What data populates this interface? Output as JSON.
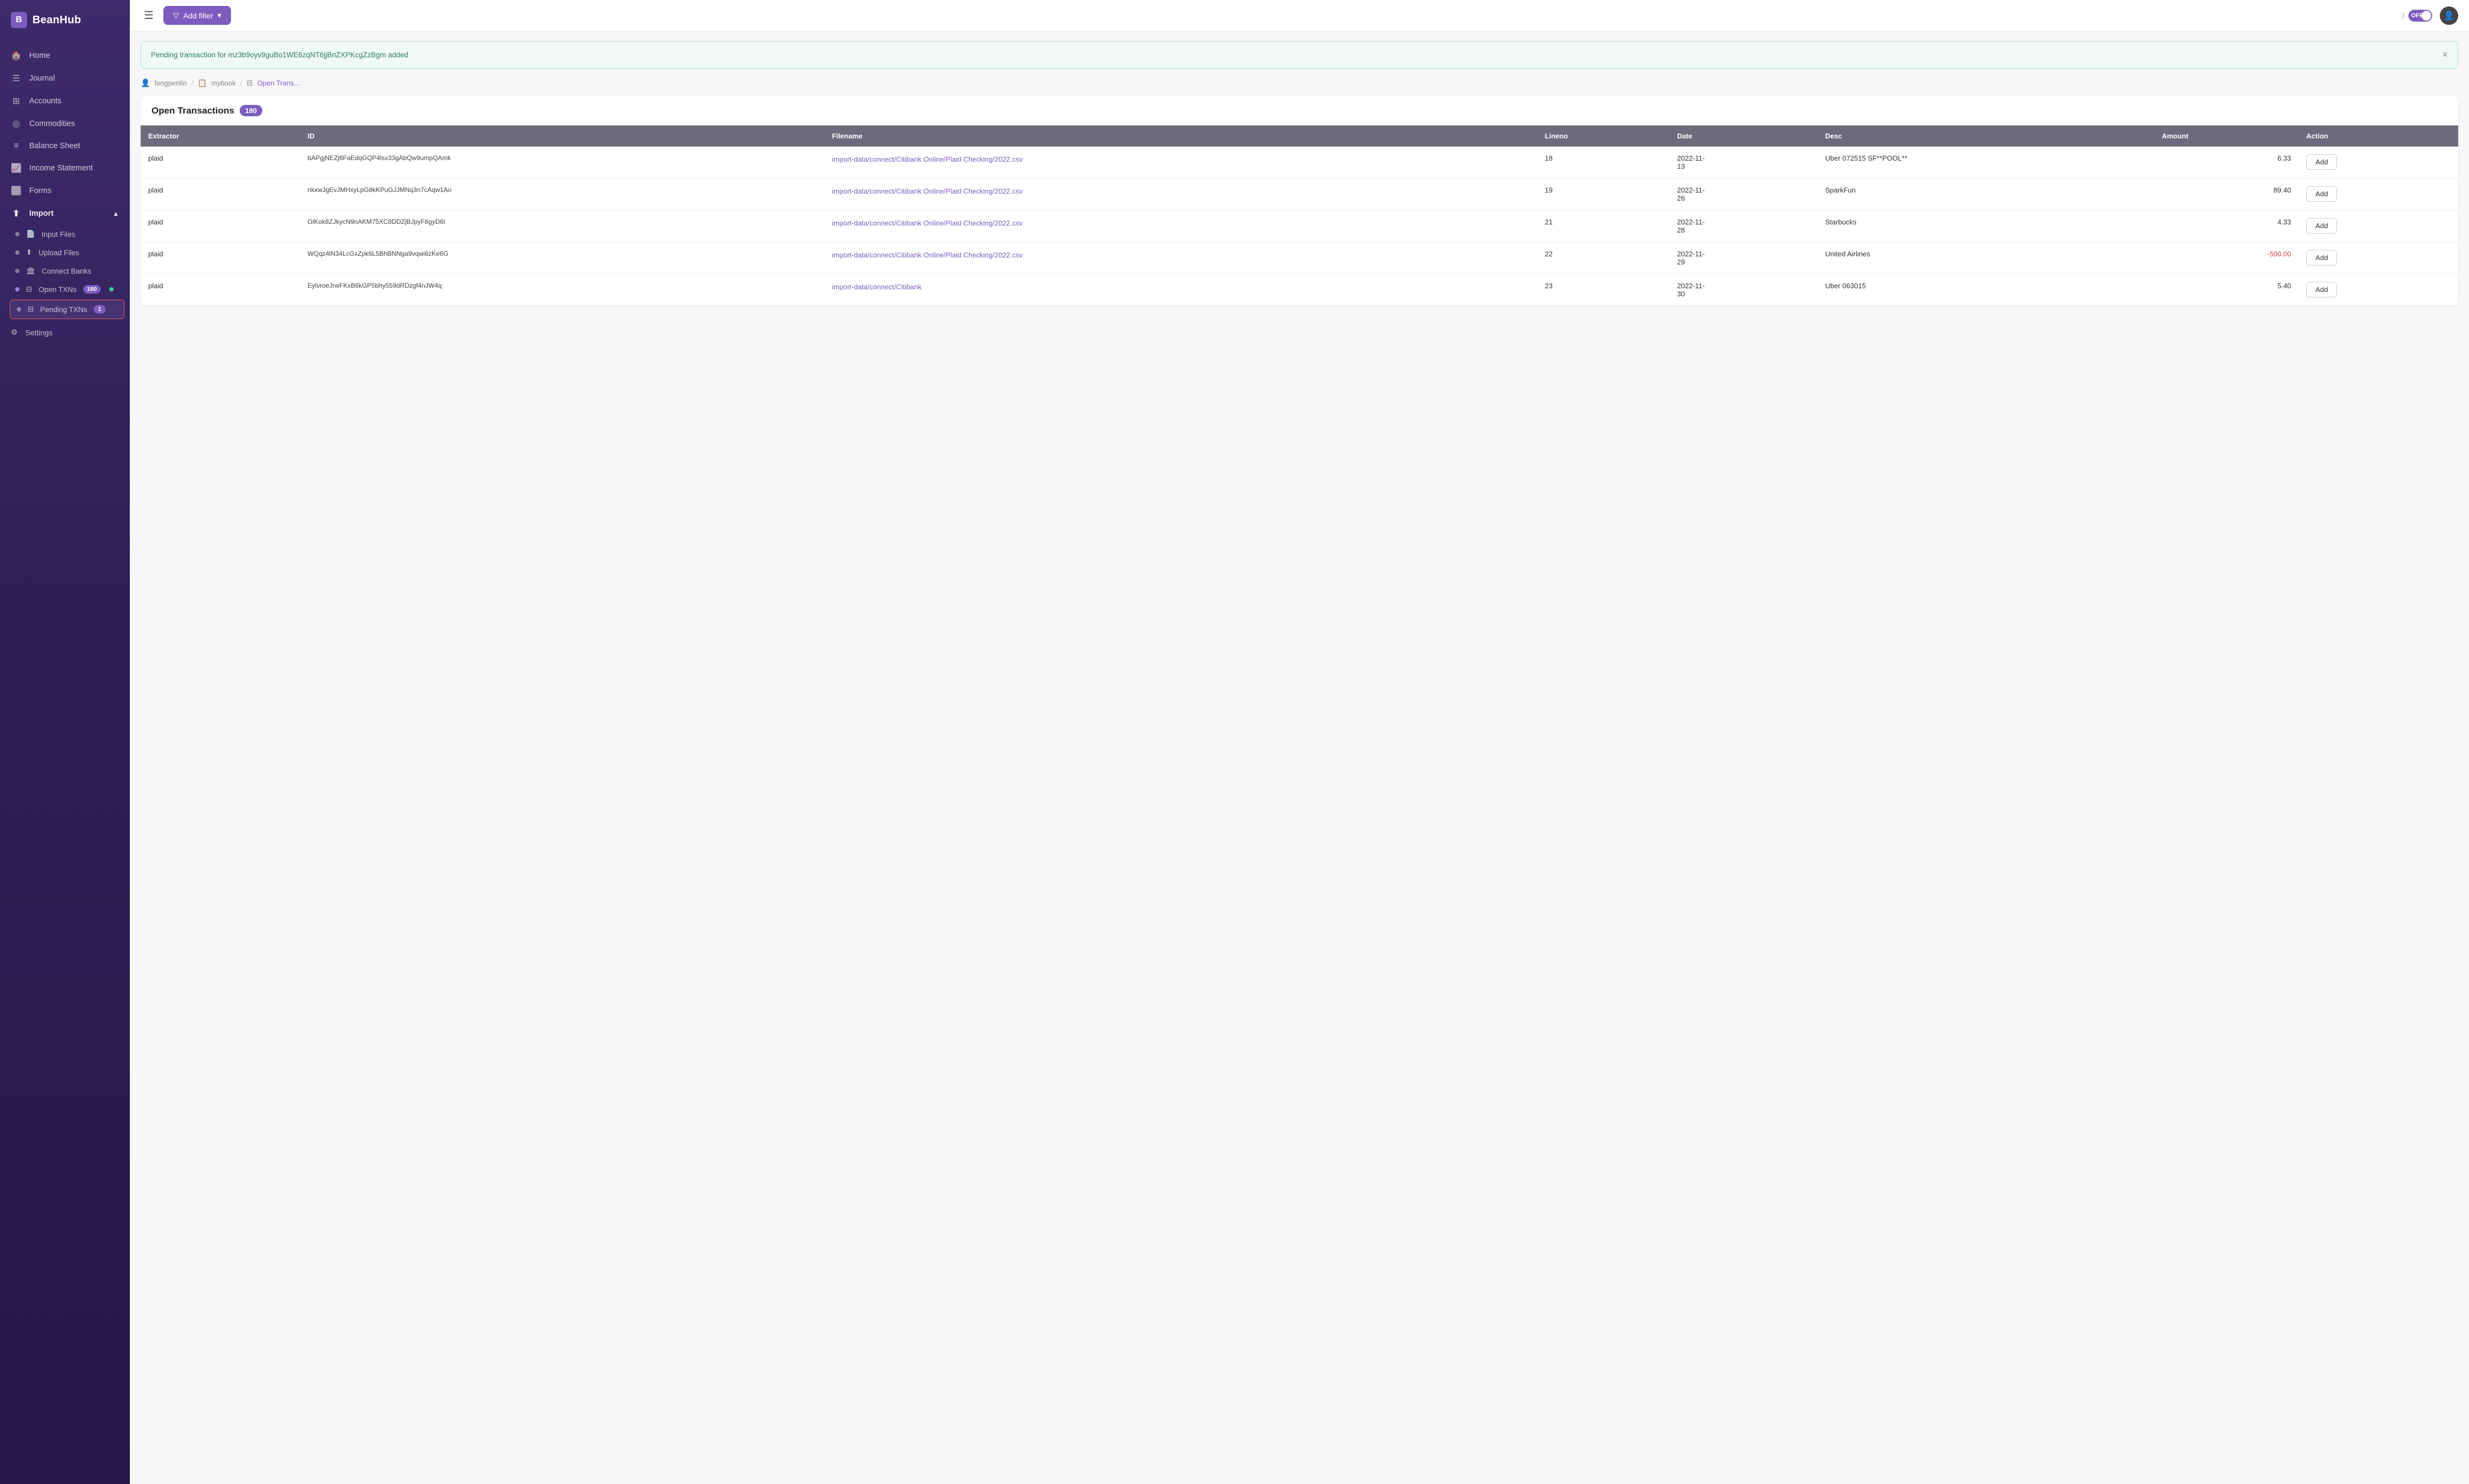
{
  "app": {
    "name": "BeanHub"
  },
  "sidebar": {
    "nav_items": [
      {
        "id": "home",
        "label": "Home",
        "icon": "🏠"
      },
      {
        "id": "journal",
        "label": "Journal",
        "icon": "☰"
      },
      {
        "id": "accounts",
        "label": "Accounts",
        "icon": "⊞"
      },
      {
        "id": "commodities",
        "label": "Commodities",
        "icon": "◎"
      },
      {
        "id": "balance_sheet",
        "label": "Balance Sheet",
        "icon": "≡"
      },
      {
        "id": "income_statement",
        "label": "Income Statement",
        "icon": "📈"
      },
      {
        "id": "forms",
        "label": "Forms",
        "icon": "⬜"
      }
    ],
    "import_label": "Import",
    "import_sub_items": [
      {
        "id": "input_files",
        "label": "Input Files",
        "icon": "📄"
      },
      {
        "id": "upload_files",
        "label": "Upload Files",
        "icon": "⬆"
      },
      {
        "id": "connect_banks",
        "label": "Connect Banks",
        "icon": "🏛"
      },
      {
        "id": "open_txns",
        "label": "Open TXNs",
        "badge": "180",
        "dot": true
      },
      {
        "id": "pending_txns",
        "label": "Pending TXNs",
        "badge": "1",
        "highlighted": true
      }
    ],
    "settings_label": "Settings"
  },
  "topbar": {
    "menu_icon": "☰",
    "filter_button": "Add filter",
    "dark_mode_label": "OFF",
    "moon_icon": "☽"
  },
  "notification": {
    "message": "Pending transaction for mz3b9oyv9guBo1WE6zqNT6jjBnZXPKcgZzBgm added",
    "close_icon": "×"
  },
  "breadcrumb": {
    "user": "fangpenlin",
    "book": "mybook",
    "page": "Open Trans..."
  },
  "open_transactions": {
    "title": "Open Transactions",
    "count": 180,
    "columns": [
      "Extractor",
      "ID",
      "Filename",
      "Lineno",
      "Date",
      "Desc",
      "Amount",
      "Action"
    ],
    "rows": [
      {
        "extractor": "plaid",
        "id": "bAPgjNEZj6FaEdqGQP4lsx33gAbQw9umpQAmk",
        "filename": "import-data/connect/Citibank Online/Plaid Checking/2022.csv",
        "lineno": "18",
        "date": "2022-11-13",
        "desc": "Uber 072515 SF**POOL**",
        "amount": "6.33",
        "action": "Add"
      },
      {
        "extractor": "plaid",
        "id": "nkxwJgEvJMHxyLpG8kKPuGJJMNq3n7cAqw1Ao",
        "filename": "import-data/connect/Citibank Online/Plaid Checking/2022.csv",
        "lineno": "19",
        "date": "2022-11-26",
        "desc": "SparkFun",
        "amount": "89.40",
        "action": "Add"
      },
      {
        "extractor": "plaid",
        "id": "GlKok8ZJkycN9nAKM75XC8DDZjBJpyF6gyD6l",
        "filename": "import-data/connect/Citibank Online/Plaid Checking/2022.csv",
        "lineno": "21",
        "date": "2022-11-28",
        "desc": "Starbucks",
        "amount": "4.33",
        "action": "Add"
      },
      {
        "extractor": "plaid",
        "id": "WQqz4lN34LcGxZpk6L5BhBNNga9vqwi6zKe6G",
        "filename": "import-data/connect/Citibank Online/Plaid Checking/2022.csv",
        "lineno": "22",
        "date": "2022-11-29",
        "desc": "United Airlines",
        "amount": "-500.00",
        "action": "Add"
      },
      {
        "extractor": "plaid",
        "id": "EylvroeJrwFKxB6kGP5bhy559dRDzgf4nJW4q",
        "filename": "import-data/connect/Citibank",
        "lineno": "23",
        "date": "2022-11-30",
        "desc": "Uber 063015",
        "amount": "5.40",
        "action": "Add"
      }
    ]
  }
}
